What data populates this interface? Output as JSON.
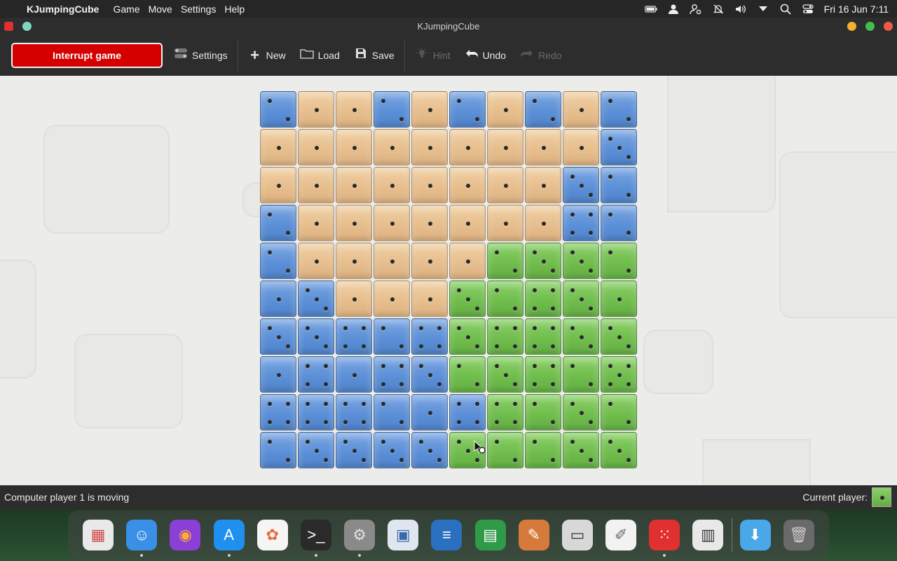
{
  "menubar": {
    "app_name": "KJumpingCube",
    "menus": [
      "Game",
      "Move",
      "Settings",
      "Help"
    ],
    "clock": "Fri 16 Jun  7:11"
  },
  "window": {
    "title": "KJumpingCube"
  },
  "toolbar": {
    "interrupt_label": "Interrupt game",
    "settings_label": "Settings",
    "new_label": "New",
    "load_label": "Load",
    "save_label": "Save",
    "hint_label": "Hint",
    "undo_label": "Undo",
    "redo_label": "Redo"
  },
  "board": {
    "size": 10,
    "colors": {
      "b": "#5a8ed6",
      "o": "#e6bd8c",
      "g": "#6fbc4c"
    },
    "rows": [
      [
        "b2",
        "o1",
        "o1",
        "b2",
        "o1",
        "b2",
        "o1",
        "b2",
        "o1",
        "b2"
      ],
      [
        "o1",
        "o1",
        "o1",
        "o1",
        "o1",
        "o1",
        "o1",
        "o1",
        "o1",
        "b3"
      ],
      [
        "o1",
        "o1",
        "o1",
        "o1",
        "o1",
        "o1",
        "o1",
        "o1",
        "b3",
        "b2"
      ],
      [
        "b2",
        "o1",
        "o1",
        "o1",
        "o1",
        "o1",
        "o1",
        "o1",
        "b4",
        "b2"
      ],
      [
        "b2",
        "o1",
        "o1",
        "o1",
        "o1",
        "o1",
        "g2",
        "g3",
        "g3",
        "g2"
      ],
      [
        "b1",
        "b3",
        "o1",
        "o1",
        "o1",
        "g3",
        "g2",
        "g4",
        "g3",
        "g1"
      ],
      [
        "b3",
        "b3",
        "b4",
        "b2",
        "b4",
        "g3",
        "g4",
        "g4",
        "g3",
        "g3"
      ],
      [
        "b1",
        "b4",
        "b1",
        "b4",
        "b3",
        "g2",
        "g3",
        "g4",
        "g2",
        "g5"
      ],
      [
        "b4",
        "b4",
        "b4",
        "b2",
        "b1",
        "b4",
        "g4",
        "g2",
        "g3",
        "g2"
      ],
      [
        "b2",
        "b3",
        "b3",
        "b3",
        "b3",
        "g3",
        "g2",
        "g2",
        "g3",
        "g3"
      ]
    ]
  },
  "statusbar": {
    "message": "Computer player 1 is moving",
    "current_player_label": "Current player:",
    "current_player_color": "#6fbc4c"
  },
  "dock": {
    "apps": [
      {
        "icon": "launchpad-icon",
        "bg": "#e9e9e9",
        "glyph": "▦",
        "fg": "#d04a4a",
        "running": false
      },
      {
        "icon": "finder-icon",
        "bg": "#3a8fe6",
        "glyph": "☺",
        "fg": "#ffffff",
        "running": true
      },
      {
        "icon": "firefox-icon",
        "bg": "#8a3fd6",
        "glyph": "◉",
        "fg": "#ffae33",
        "running": false
      },
      {
        "icon": "app-store-icon",
        "bg": "#1f8ff0",
        "glyph": "A",
        "fg": "#ffffff",
        "running": true
      },
      {
        "icon": "photos-icon",
        "bg": "#f5f5f5",
        "glyph": "✿",
        "fg": "#e86a3a",
        "running": false
      },
      {
        "icon": "terminal-icon",
        "bg": "#2a2a2a",
        "glyph": ">_",
        "fg": "#ffffff",
        "running": true
      },
      {
        "icon": "system-preferences-icon",
        "bg": "#8a8a8a",
        "glyph": "⚙",
        "fg": "#e0e0e0",
        "running": true
      },
      {
        "icon": "image-viewer-icon",
        "bg": "#dfe6ef",
        "glyph": "▣",
        "fg": "#3a6aa8",
        "running": false
      },
      {
        "icon": "writer-icon",
        "bg": "#2a6fc0",
        "glyph": "≡",
        "fg": "#ffffff",
        "running": false
      },
      {
        "icon": "calc-icon",
        "bg": "#2f9a47",
        "glyph": "▤",
        "fg": "#ffffff",
        "running": false
      },
      {
        "icon": "draw-icon",
        "bg": "#d57a3a",
        "glyph": "✎",
        "fg": "#ffffff",
        "running": false
      },
      {
        "icon": "tape-icon",
        "bg": "#d8d8d8",
        "glyph": "▭",
        "fg": "#333333",
        "running": false
      },
      {
        "icon": "text-editor-icon",
        "bg": "#f2f2f2",
        "glyph": "✐",
        "fg": "#666666",
        "running": false
      },
      {
        "icon": "kjumpingcube-icon",
        "bg": "#e03030",
        "glyph": "⁙",
        "fg": "#ffffff",
        "running": true
      },
      {
        "icon": "calculator-icon",
        "bg": "#e8e8e8",
        "glyph": "▥",
        "fg": "#333333",
        "running": false
      }
    ],
    "extras": [
      {
        "icon": "downloads-folder-icon",
        "bg": "#4aa8e8",
        "glyph": "⬇",
        "fg": "#ffffff"
      },
      {
        "icon": "trash-icon",
        "bg": "#6a6a6a",
        "glyph": "🗑",
        "fg": "#cccccc"
      }
    ]
  }
}
